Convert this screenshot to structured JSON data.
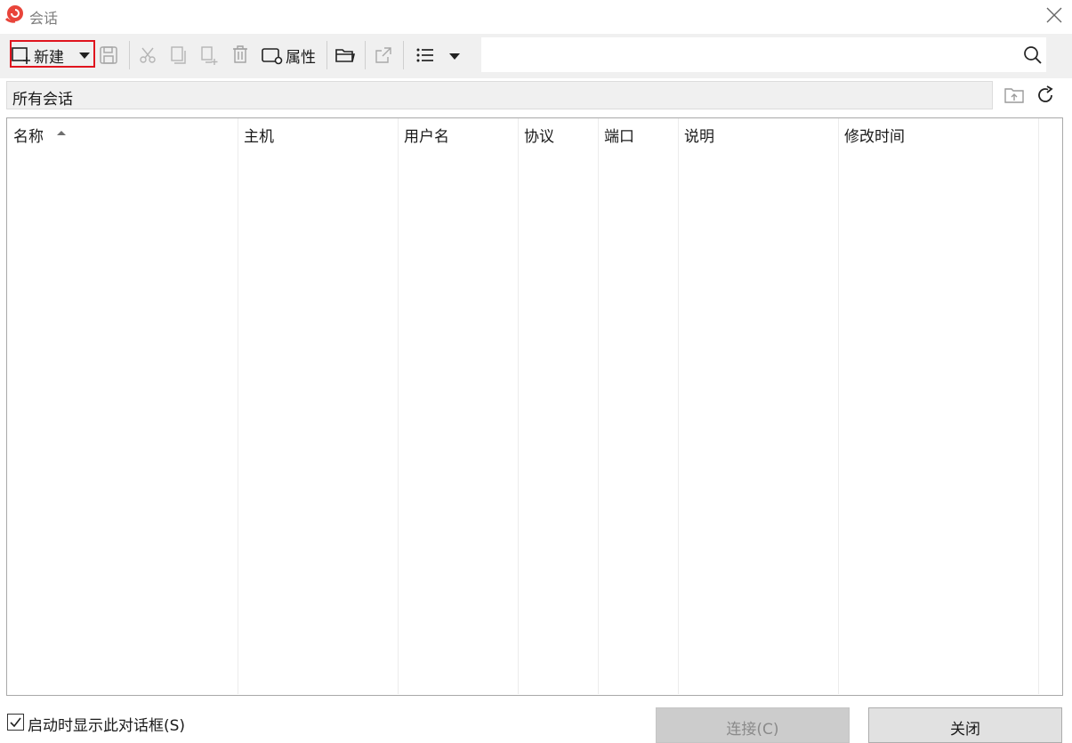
{
  "window": {
    "title": "会话"
  },
  "toolbar": {
    "new_label": "新建",
    "properties_label": "属性",
    "search_placeholder": ""
  },
  "path_bar": {
    "text": "所有会话"
  },
  "table": {
    "columns": [
      "名称",
      "主机",
      "用户名",
      "协议",
      "端口",
      "说明",
      "修改时间"
    ],
    "sort_column": "名称",
    "sort_direction": "ascending",
    "rows": []
  },
  "footer": {
    "checkbox_label": "启动时显示此对话框(S)",
    "checkbox_checked": true,
    "connect_label": "连接(C)",
    "close_label": "关闭"
  },
  "colors": {
    "highlight_border": "#e0141e",
    "app_icon": "#e8443a"
  }
}
